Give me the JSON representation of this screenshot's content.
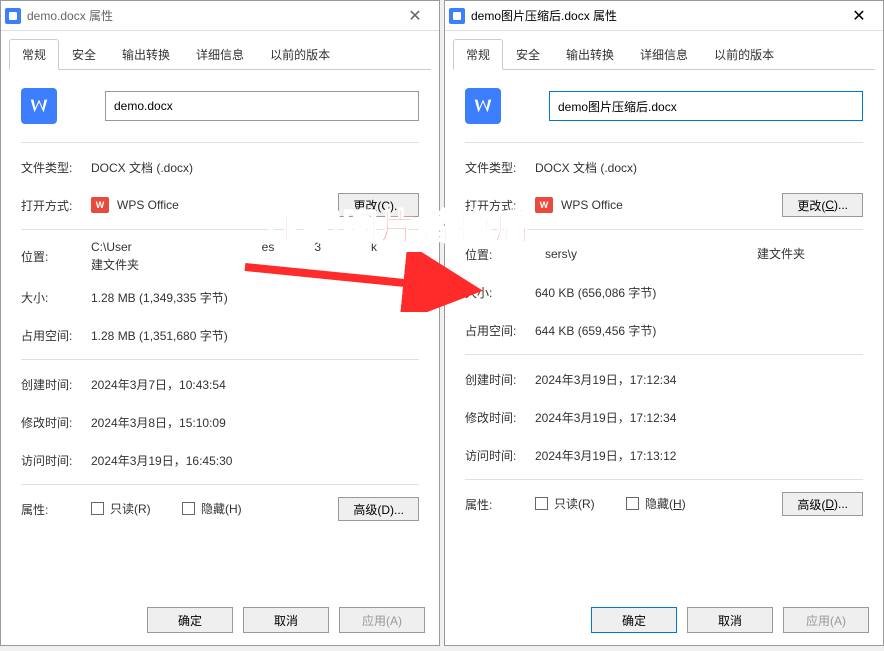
{
  "annotation_text": "压缩图片替换后",
  "close_glyph": "✕",
  "tabs": [
    "常规",
    "安全",
    "输出转换",
    "详细信息",
    "以前的版本"
  ],
  "labels": {
    "file_type": "文件类型:",
    "open_with": "打开方式:",
    "location": "位置:",
    "size": "大小:",
    "disk_size": "占用空间:",
    "created": "创建时间:",
    "modified": "修改时间:",
    "accessed": "访问时间:",
    "attributes": "属性:",
    "readonly": "只读(R)",
    "hidden": "隐藏(H)",
    "hidden_u": "隐藏(",
    "hidden_u2": ")",
    "advanced": "高级(D)...",
    "advanced_u": "高级(",
    "advanced_u2": ")...",
    "change": "更改(C)...",
    "change_u": "更改(",
    "change_u2": ")...",
    "ok": "确定",
    "cancel": "取消",
    "apply": "应用(A)"
  },
  "left": {
    "title": "demo.docx 属性",
    "filename": "demo.docx",
    "file_type_val": "DOCX 文档 (.docx)",
    "open_with_val": "WPS Office",
    "location_val_pre": "C:\\User",
    "location_val_post": "建文件夹",
    "size_val": "1.28 MB (1,349,335 字节)",
    "disk_size_val": "1.28 MB (1,351,680 字节)",
    "created_val": "2024年3月7日，10:43:54",
    "modified_val": "2024年3月8日，15:10:09",
    "accessed_val": "2024年3月19日，16:45:30"
  },
  "right": {
    "title": "demo图片压缩后.docx 属性",
    "filename": "demo图片压缩后.docx",
    "file_type_val": "DOCX 文档 (.docx)",
    "open_with_val": "WPS Office",
    "location_val_pre": "sers\\y",
    "location_val_post": "建文件夹",
    "size_val": "640 KB (656,086 字节)",
    "disk_size_val": "644 KB (659,456 字节)",
    "created_val": "2024年3月19日，17:12:34",
    "modified_val": "2024年3月19日，17:12:34",
    "accessed_val": "2024年3月19日，17:13:12"
  }
}
